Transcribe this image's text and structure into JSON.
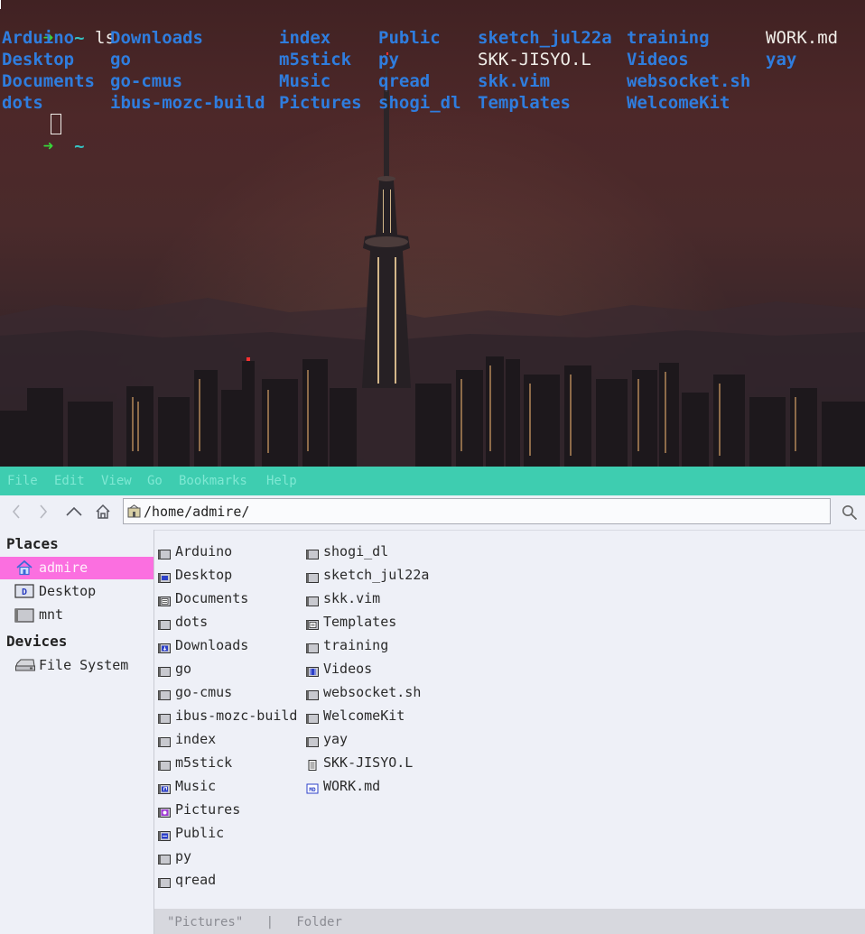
{
  "terminal": {
    "prompt_arrow": "➜",
    "prompt_dir": "~",
    "command": "ls",
    "ls_output": {
      "directories": [
        "Arduino",
        "Desktop",
        "Documents",
        "dots",
        "Downloads",
        "go",
        "go-cmus",
        "ibus-mozc-build",
        "index",
        "m5stick",
        "Music",
        "Pictures",
        "Public",
        "py",
        "qread",
        "shogi_dl",
        "sketch_jul22a",
        "skk.vim",
        "Templates",
        "training",
        "Videos",
        "websocket.sh",
        "WelcomeKit",
        "yay"
      ],
      "columns": [
        [
          "Arduino",
          "Desktop",
          "Documents",
          "dots"
        ],
        [
          "Downloads",
          "go",
          "go-cmus",
          "ibus-mozc-build"
        ],
        [
          "index",
          "m5stick",
          "Music",
          "Pictures"
        ],
        [
          "Public",
          "py",
          "qread",
          "shogi_dl"
        ],
        [
          "sketch_jul22a",
          "SKK-JISYO.L",
          "skk.vim",
          "Templates"
        ],
        [
          "training",
          "Videos",
          "websocket.sh",
          "WelcomeKit"
        ],
        [
          "WORK.md",
          "yay"
        ]
      ],
      "plain_files": [
        "SKK-JISYO.L",
        "WORK.md"
      ]
    }
  },
  "file_manager": {
    "menu": [
      "File",
      "Edit",
      "View",
      "Go",
      "Bookmarks",
      "Help"
    ],
    "toolbar": {
      "back_icon": "chevron-left-icon",
      "forward_icon": "chevron-right-icon",
      "up_icon": "chevron-up-icon",
      "home_icon": "home-icon",
      "path": "/home/admire/",
      "search_icon": "search-icon"
    },
    "sidebar": {
      "places_heading": "Places",
      "places": [
        {
          "label": "admire",
          "icon": "home-icon",
          "selected": true
        },
        {
          "label": "Desktop",
          "icon": "desktop-icon",
          "selected": false
        },
        {
          "label": "mnt",
          "icon": "folder-icon",
          "selected": false
        }
      ],
      "devices_heading": "Devices",
      "devices": [
        {
          "label": "File System",
          "icon": "drive-icon"
        }
      ]
    },
    "files_col1": [
      {
        "name": "Arduino",
        "icon": "folder-icon"
      },
      {
        "name": "Desktop",
        "icon": "desktop-folder-icon"
      },
      {
        "name": "Documents",
        "icon": "documents-folder-icon"
      },
      {
        "name": "dots",
        "icon": "folder-icon"
      },
      {
        "name": "Downloads",
        "icon": "downloads-folder-icon"
      },
      {
        "name": "go",
        "icon": "folder-icon"
      },
      {
        "name": "go-cmus",
        "icon": "folder-icon"
      },
      {
        "name": "ibus-mozc-build",
        "icon": "folder-icon"
      },
      {
        "name": "index",
        "icon": "folder-icon"
      },
      {
        "name": "m5stick",
        "icon": "folder-icon"
      },
      {
        "name": "Music",
        "icon": "music-folder-icon"
      },
      {
        "name": "Pictures",
        "icon": "pictures-folder-icon"
      },
      {
        "name": "Public",
        "icon": "public-folder-icon"
      },
      {
        "name": "py",
        "icon": "folder-icon"
      },
      {
        "name": "qread",
        "icon": "folder-icon"
      }
    ],
    "files_col2": [
      {
        "name": "shogi_dl",
        "icon": "folder-icon"
      },
      {
        "name": "sketch_jul22a",
        "icon": "folder-icon"
      },
      {
        "name": "skk.vim",
        "icon": "folder-icon"
      },
      {
        "name": "Templates",
        "icon": "templates-folder-icon"
      },
      {
        "name": "training",
        "icon": "folder-icon"
      },
      {
        "name": "Videos",
        "icon": "videos-folder-icon"
      },
      {
        "name": "websocket.sh",
        "icon": "folder-icon"
      },
      {
        "name": "WelcomeKit",
        "icon": "folder-icon"
      },
      {
        "name": "yay",
        "icon": "folder-icon"
      },
      {
        "name": "SKK-JISYO.L",
        "icon": "text-file-icon"
      },
      {
        "name": "WORK.md",
        "icon": "markdown-file-icon"
      }
    ],
    "status": {
      "selection": "\"Pictures\"",
      "separator": "|",
      "type": "Folder"
    }
  },
  "colors": {
    "menubar": "#3ecdb0",
    "selected_place": "#fb6fe0",
    "dir_text": "#2f7dde",
    "prompt_arrow": "#38d63a",
    "prompt_dir": "#35c3c3"
  }
}
